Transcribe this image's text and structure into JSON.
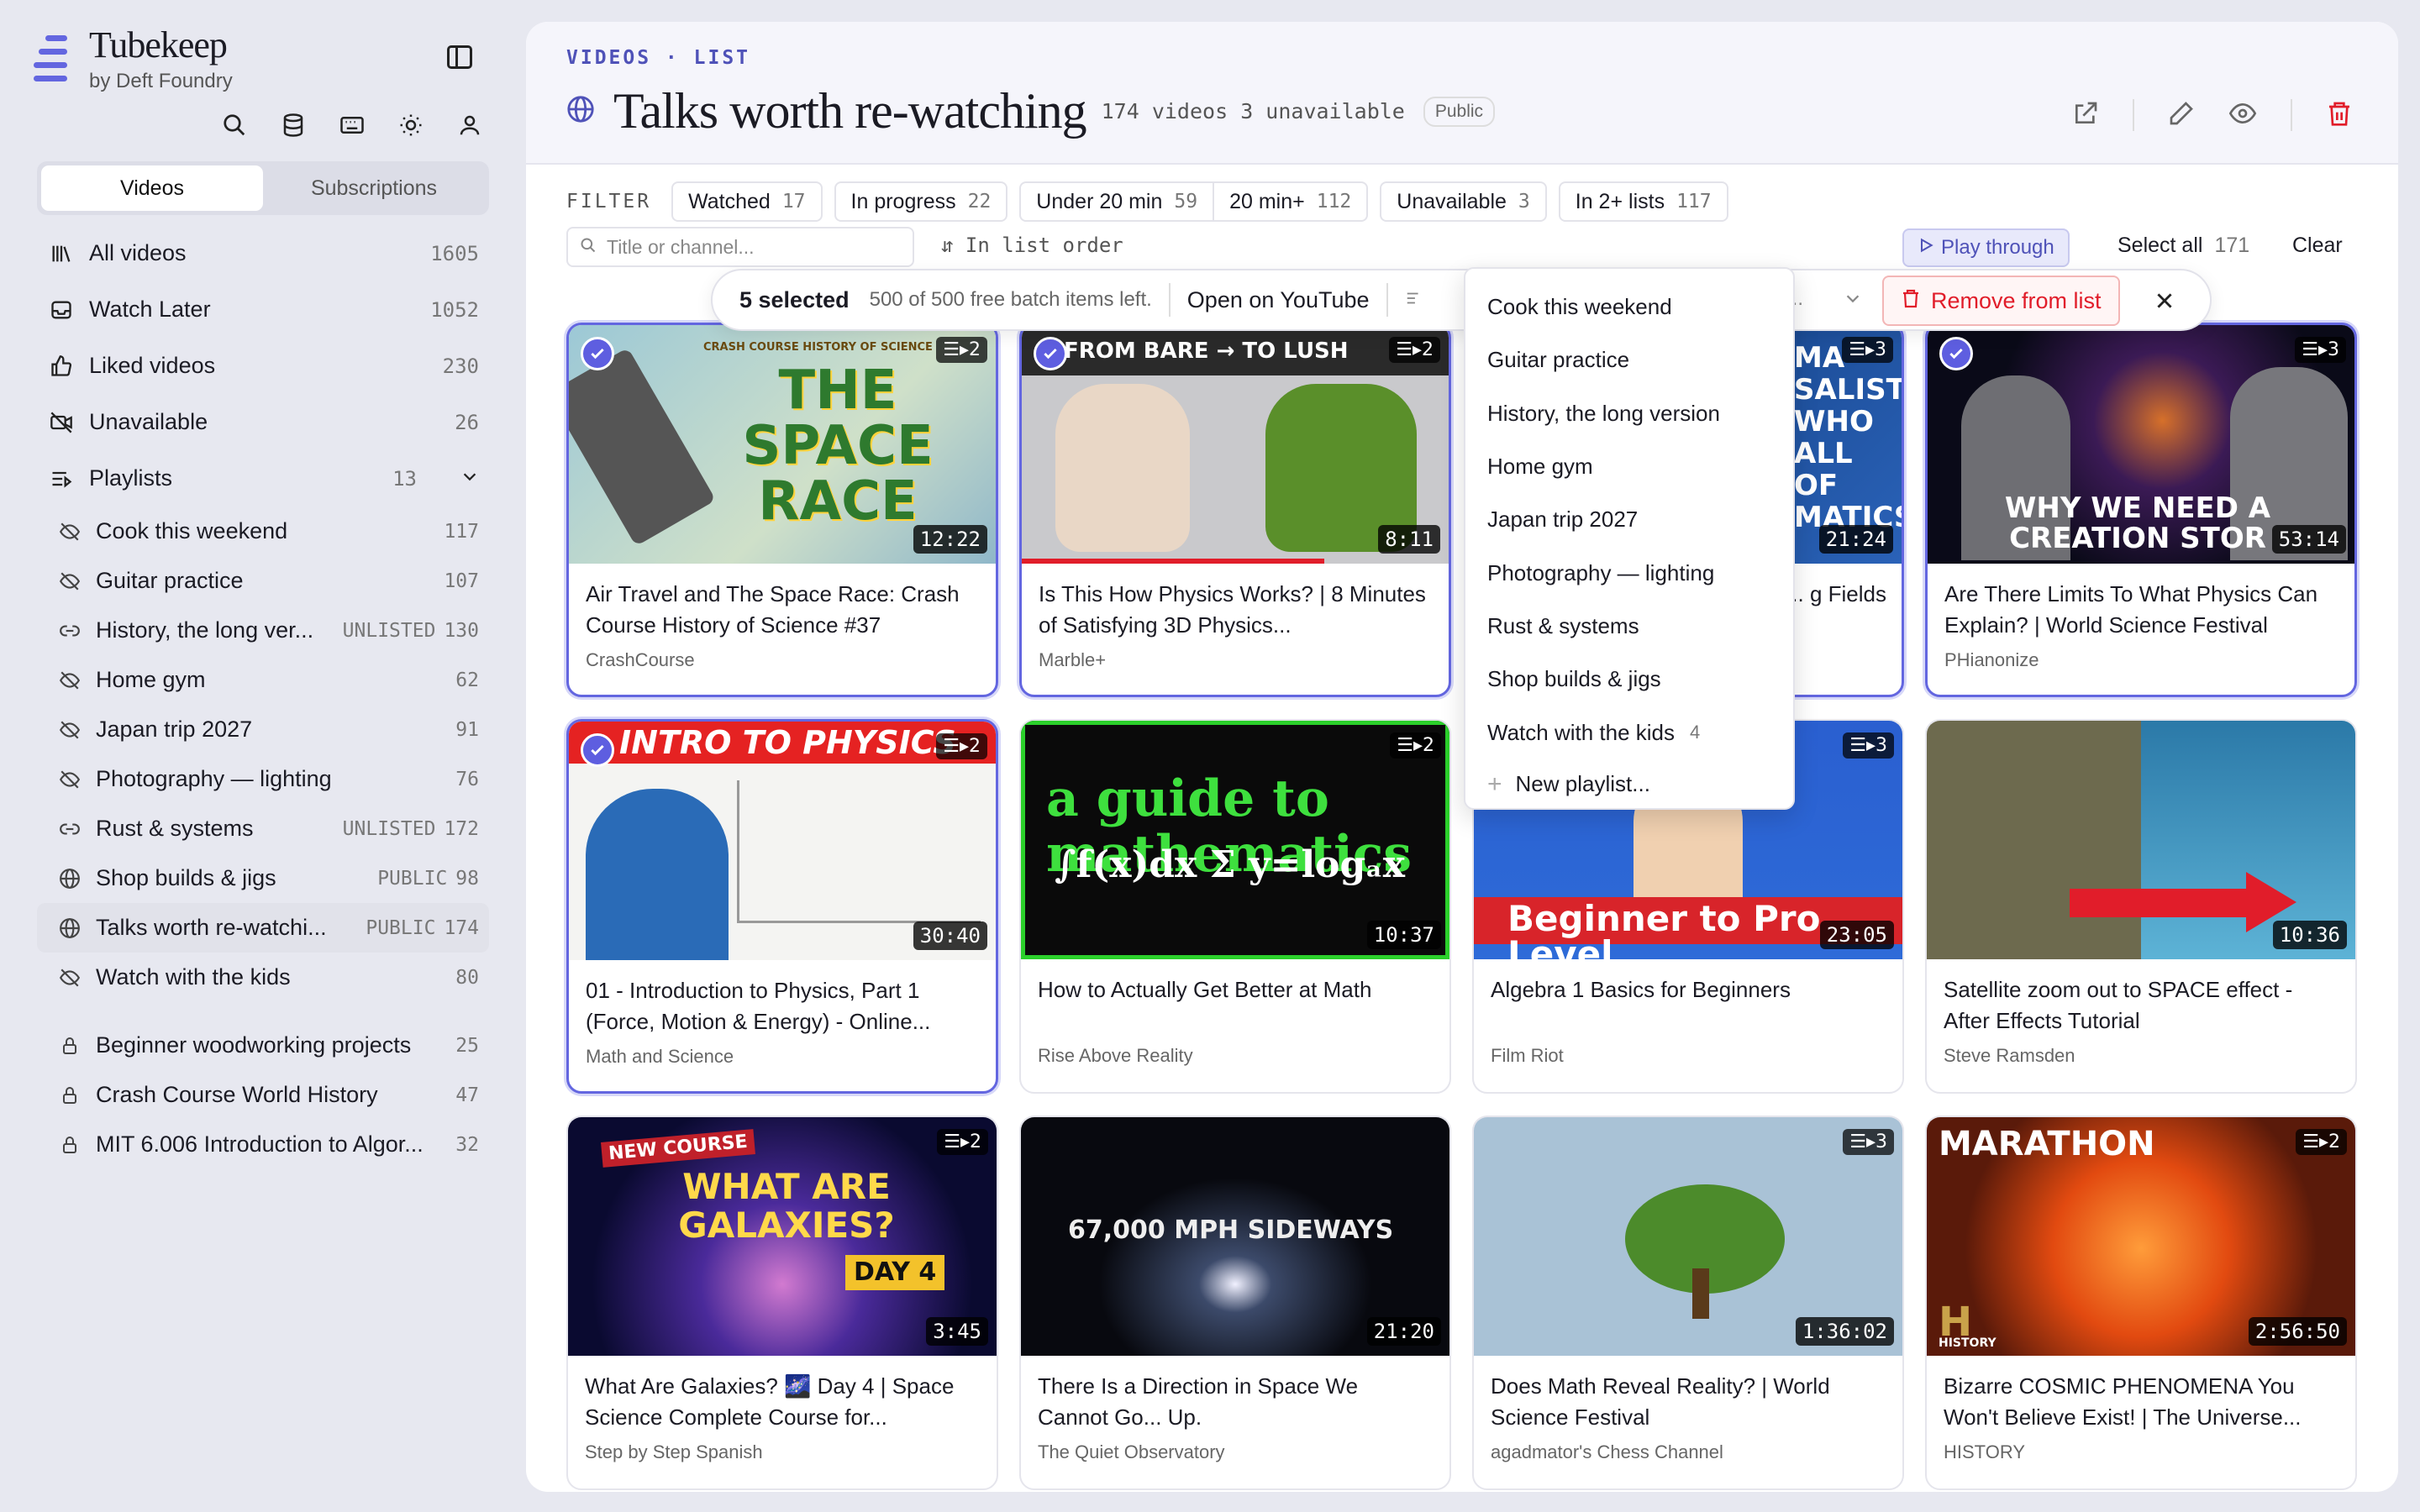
{
  "brand": {
    "name": "Tubekeep",
    "subtitle": "by Deft Foundry"
  },
  "tabs": [
    "Videos",
    "Subscriptions"
  ],
  "nav": [
    {
      "label": "All videos",
      "count": "1605",
      "icon": "library-icon"
    },
    {
      "label": "Watch Later",
      "count": "1052",
      "icon": "inbox-icon"
    },
    {
      "label": "Liked videos",
      "count": "230",
      "icon": "thumbs-up-icon"
    },
    {
      "label": "Unavailable",
      "count": "26",
      "icon": "video-off-icon"
    },
    {
      "label": "Playlists",
      "count": "13",
      "icon": "playlist-icon"
    }
  ],
  "playlists": [
    {
      "label": "Cook this weekend",
      "vis": "",
      "count": "117",
      "icon": "eye-off-icon"
    },
    {
      "label": "Guitar practice",
      "vis": "",
      "count": "107",
      "icon": "eye-off-icon"
    },
    {
      "label": "History, the long ver...",
      "vis": "UNLISTED",
      "count": "130",
      "icon": "link-icon"
    },
    {
      "label": "Home gym",
      "vis": "",
      "count": "62",
      "icon": "eye-off-icon"
    },
    {
      "label": "Japan trip 2027",
      "vis": "",
      "count": "91",
      "icon": "eye-off-icon"
    },
    {
      "label": "Photography — lighting",
      "vis": "",
      "count": "76",
      "icon": "eye-off-icon"
    },
    {
      "label": "Rust & systems",
      "vis": "UNLISTED",
      "count": "172",
      "icon": "link-icon"
    },
    {
      "label": "Shop builds & jigs",
      "vis": "PUBLIC",
      "count": "98",
      "icon": "globe-icon"
    },
    {
      "label": "Talks worth re-watchi...",
      "vis": "PUBLIC",
      "count": "174",
      "icon": "globe-icon"
    },
    {
      "label": "Watch with the kids",
      "vis": "",
      "count": "80",
      "icon": "eye-off-icon"
    }
  ],
  "locked": [
    {
      "label": "Beginner woodworking projects",
      "count": "25"
    },
    {
      "label": "Crash Course World History",
      "count": "47"
    },
    {
      "label": "MIT 6.006 Introduction to Algor...",
      "count": "32"
    }
  ],
  "header": {
    "crumb": "VIDEOS · LIST",
    "title": "Talks worth re-watching",
    "meta": "174 videos 3 unavailable",
    "badge": "Public"
  },
  "filter": {
    "label": "FILTER",
    "chips": [
      {
        "label": "Watched",
        "n": "17"
      },
      {
        "label": "In progress",
        "n": "22"
      },
      {
        "label": "Under 20 min",
        "n": "59"
      },
      {
        "label": "20 min+",
        "n": "112"
      },
      {
        "label": "Unavailable",
        "n": "3"
      },
      {
        "label": "In 2+ lists",
        "n": "117"
      }
    ],
    "search_placeholder": "Title or channel...",
    "order": "⇵ In list order",
    "play": "Play through",
    "select_all": "Select all",
    "select_count": "171",
    "clear": "Clear"
  },
  "selection": {
    "count": "5 selected",
    "free": "500 of 500 free batch items left.",
    "open": "Open on YouTube",
    "remove": "Remove from list"
  },
  "dropdown": {
    "items": [
      {
        "label": "Cook this weekend",
        "n": ""
      },
      {
        "label": "Guitar practice",
        "n": ""
      },
      {
        "label": "History, the long version",
        "n": ""
      },
      {
        "label": "Home gym",
        "n": ""
      },
      {
        "label": "Japan trip 2027",
        "n": ""
      },
      {
        "label": "Photography — lighting",
        "n": ""
      },
      {
        "label": "Rust & systems",
        "n": ""
      },
      {
        "label": "Shop builds & jigs",
        "n": ""
      },
      {
        "label": "Watch with the kids",
        "n": "4"
      }
    ],
    "new": "New playlist..."
  },
  "videos": [
    {
      "title": "Air Travel and The Space Race: Crash Course History of Science #37",
      "channel": "CrashCourse",
      "duration": "12:22",
      "lists": "2",
      "selected": true,
      "thumb_text": "THE SPACE RACE"
    },
    {
      "title": "Is This How Physics Works? | 8 Minutes of Satisfying 3D Physics...",
      "channel": "Marble+",
      "duration": "8:11",
      "lists": "2",
      "selected": true,
      "thumb_text": "FROM BARE → TO LUSH"
    },
    {
      "title": "... g Fields",
      "channel": "",
      "duration": "21:24",
      "lists": "3",
      "selected": true,
      "thumb_text": "MA SALIST WHO ALL OF MATICS"
    },
    {
      "title": "Are There Limits To What Physics Can Explain? | World Science Festival",
      "channel": "PHianonize",
      "duration": "53:14",
      "lists": "3",
      "selected": true,
      "thumb_text": "WHY WE NEED A CREATION STOR"
    },
    {
      "title": "01 - Introduction to Physics, Part 1 (Force, Motion & Energy) - Online...",
      "channel": "Math and Science",
      "duration": "30:40",
      "lists": "2",
      "selected": true,
      "thumb_text": "INTRO TO PHYSICS"
    },
    {
      "title": "How to Actually Get Better at Math",
      "channel": "Rise Above Reality",
      "duration": "10:37",
      "lists": "2",
      "selected": false,
      "thumb_text": "a guide to mathematics"
    },
    {
      "title": "Algebra 1 Basics for Beginners",
      "channel": "Film Riot",
      "duration": "23:05",
      "lists": "3",
      "selected": false,
      "thumb_text": "Beginner to Pro Level"
    },
    {
      "title": "Satellite zoom out to SPACE effect - After Effects Tutorial",
      "channel": "Steve Ramsden",
      "duration": "10:36",
      "lists": "",
      "selected": false,
      "thumb_text": ""
    },
    {
      "title": "What Are Galaxies? 🌌 Day 4 | Space Science Complete Course for...",
      "channel": "Step by Step Spanish",
      "duration": "3:45",
      "lists": "2",
      "selected": false,
      "thumb_text": "WHAT ARE GALAXIES?"
    },
    {
      "title": "There Is a Direction in Space We Cannot Go... Up.",
      "channel": "The Quiet Observatory",
      "duration": "21:20",
      "lists": "",
      "selected": false,
      "thumb_text": "67,000 MPH SIDEWAYS"
    },
    {
      "title": "Does Math Reveal Reality? | World Science Festival",
      "channel": "agadmator's Chess Channel",
      "duration": "1:36:02",
      "lists": "3",
      "selected": false,
      "thumb_text": ""
    },
    {
      "title": "Bizarre COSMIC PHENOMENA You Won't Believe Exist! | The Universe...",
      "channel": "HISTORY",
      "duration": "2:56:50",
      "lists": "2",
      "selected": false,
      "thumb_text": "MARATHON"
    }
  ],
  "thumb_extra": {
    "crash": "CRASH COURSE HISTORY OF SCIENCE",
    "galaxy_course": "NEW COURSE",
    "galaxy_day": "DAY 4",
    "history_logo": "HISTORY"
  }
}
